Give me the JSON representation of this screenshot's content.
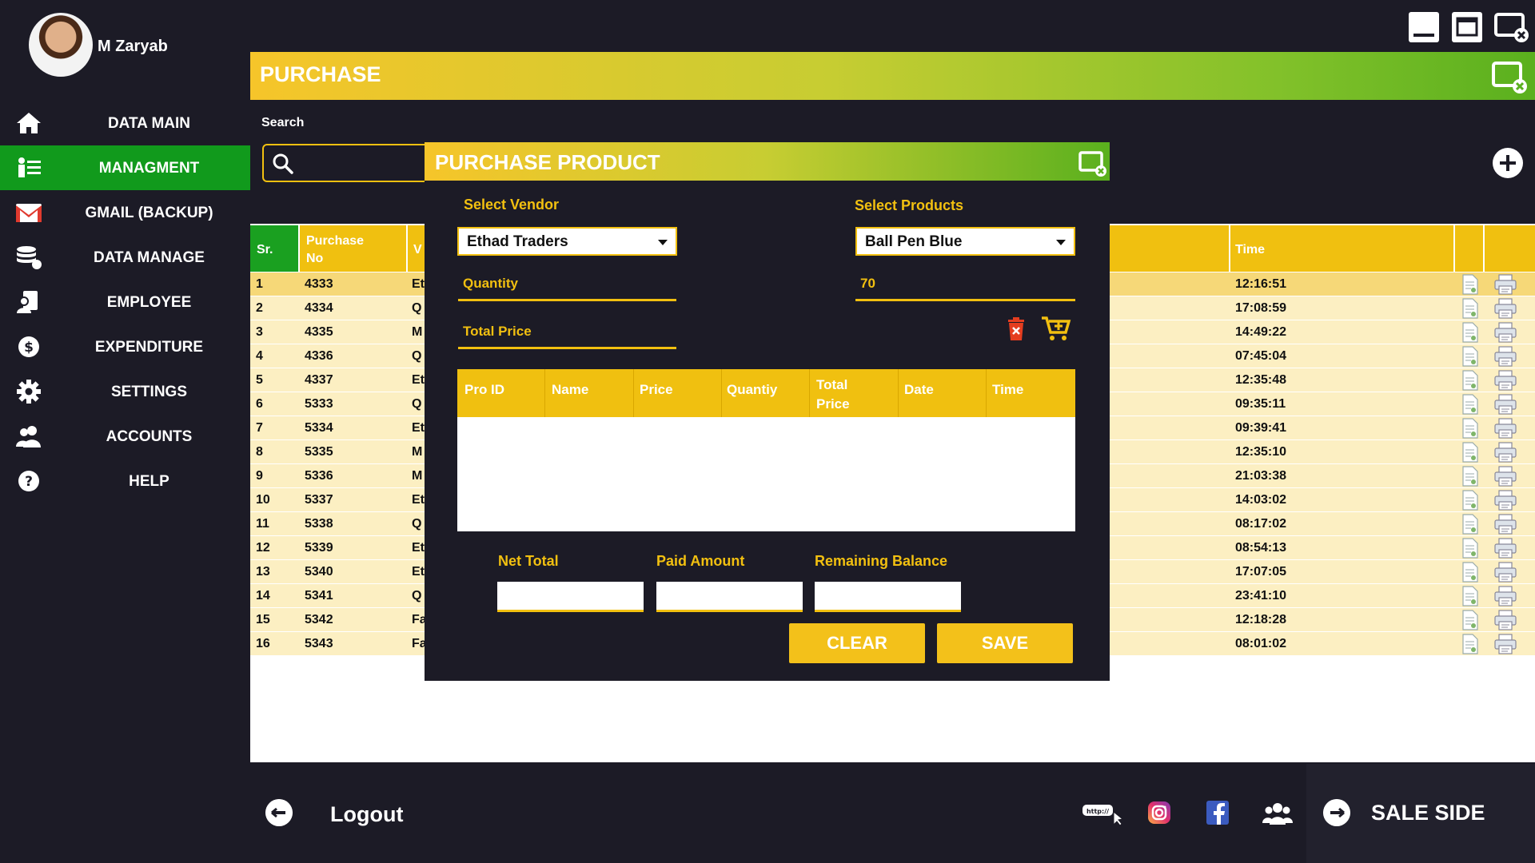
{
  "user": {
    "name": "M Zaryab"
  },
  "nav": [
    {
      "label": "DATA MAIN",
      "icon": "home-icon",
      "active": false
    },
    {
      "label": "MANAGMENT",
      "icon": "management-icon",
      "active": true
    },
    {
      "label": "GMAIL (BACKUP)",
      "icon": "gmail-icon",
      "active": false
    },
    {
      "label": "DATA MANAGE",
      "icon": "database-icon",
      "active": false
    },
    {
      "label": "EMPLOYEE",
      "icon": "employee-icon",
      "active": false
    },
    {
      "label": "EXPENDITURE",
      "icon": "dollar-icon",
      "active": false
    },
    {
      "label": "SETTINGS",
      "icon": "gear-icon",
      "active": false
    },
    {
      "label": "ACCOUNTS",
      "icon": "accounts-icon",
      "active": false
    },
    {
      "label": "HELP",
      "icon": "help-icon",
      "active": false
    }
  ],
  "page": {
    "title": "PURCHASE",
    "search_label": "Search"
  },
  "table": {
    "headers": {
      "sr": "Sr.",
      "purchase_no": "Purchase No",
      "vendor": "V",
      "time": "Time"
    },
    "rows": [
      {
        "sr": "1",
        "no": "4333",
        "v": "Et",
        "time": "12:16:51"
      },
      {
        "sr": "2",
        "no": "4334",
        "v": "Q",
        "time": "17:08:59"
      },
      {
        "sr": "3",
        "no": "4335",
        "v": "M",
        "time": "14:49:22"
      },
      {
        "sr": "4",
        "no": "4336",
        "v": "Q",
        "time": "07:45:04"
      },
      {
        "sr": "5",
        "no": "4337",
        "v": "Et",
        "time": "12:35:48"
      },
      {
        "sr": "6",
        "no": "5333",
        "v": "Q",
        "time": "09:35:11"
      },
      {
        "sr": "7",
        "no": "5334",
        "v": "Et",
        "time": "09:39:41"
      },
      {
        "sr": "8",
        "no": "5335",
        "v": "M",
        "time": "12:35:10"
      },
      {
        "sr": "9",
        "no": "5336",
        "v": "M",
        "time": "21:03:38"
      },
      {
        "sr": "10",
        "no": "5337",
        "v": "Et",
        "time": "14:03:02"
      },
      {
        "sr": "11",
        "no": "5338",
        "v": "Q",
        "time": "08:17:02"
      },
      {
        "sr": "12",
        "no": "5339",
        "v": "Et",
        "time": "08:54:13"
      },
      {
        "sr": "13",
        "no": "5340",
        "v": "Et",
        "time": "17:07:05"
      },
      {
        "sr": "14",
        "no": "5341",
        "v": "Q",
        "time": "23:41:10"
      },
      {
        "sr": "15",
        "no": "5342",
        "v": "Fa",
        "time": "12:18:28"
      },
      {
        "sr": "16",
        "no": "5343",
        "v": "Fa",
        "time": "08:01:02"
      }
    ]
  },
  "modal": {
    "title": "PURCHASE PRODUCT",
    "vendor_label": "Select Vendor",
    "vendor_value": "Ethad Traders",
    "products_label": "Select Products",
    "products_value": "Ball Pen Blue",
    "quantity_placeholder": "Quantity",
    "quantity_value": "70",
    "total_price_placeholder": "Total Price",
    "columns": [
      "Pro ID",
      "Name",
      "Price",
      "Quantiy",
      "Total Price",
      "Date",
      "Time"
    ],
    "net_total_label": "Net Total",
    "paid_amount_label": "Paid Amount",
    "remaining_label": "Remaining Balance",
    "clear_label": "CLEAR",
    "save_label": "SAVE"
  },
  "footer": {
    "logout_label": "Logout",
    "sale_label": "SALE SIDE"
  },
  "colors": {
    "accent_yellow": "#f2c010",
    "accent_green": "#119a1c",
    "bg_dark": "#1c1b26"
  }
}
